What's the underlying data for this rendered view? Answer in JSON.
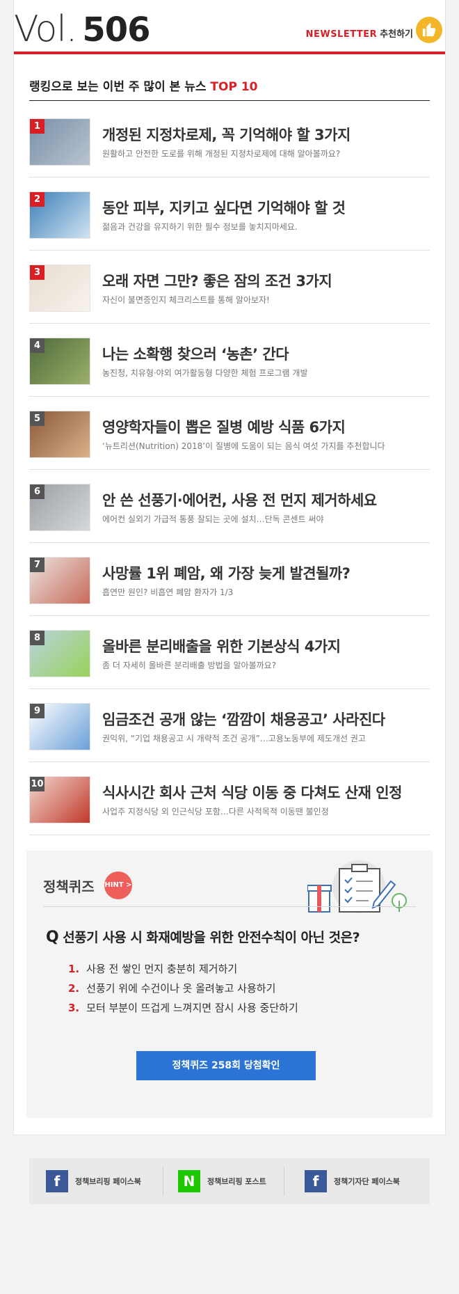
{
  "header": {
    "vol_label": "Vol.",
    "vol_number": "506",
    "newsletter_label": "NEWSLETTER",
    "recommend_label": "추천하기"
  },
  "ranking": {
    "title_prefix": "랭킹으로 보는 이번 주 많이 본 뉴스",
    "title_top": "TOP 10",
    "items": [
      {
        "rank": "1",
        "title": "개정된 지정차로제, 꼭 기억해야 할 3가지",
        "desc": "원활하고 안전한 도로를 위해 개정된 지정차로제에 대해 알아볼까요?",
        "badge_color": "#d81f26"
      },
      {
        "rank": "2",
        "title": "동안 피부, 지키고 싶다면 기억해야 할 것",
        "desc": "젊음과 건강을 유지하기 위한 필수 정보를 놓치지마세요.",
        "badge_color": "#d81f26"
      },
      {
        "rank": "3",
        "title": "오래 자면 그만? 좋은 잠의 조건 3가지",
        "desc": "자신이 불면증인지 체크리스트를 통해 알아보자!",
        "badge_color": "#d81f26"
      },
      {
        "rank": "4",
        "title": "나는 소확행 찾으러 ‘농촌’ 간다",
        "desc": "농진청, 치유형·야외 여가활동형 다양한 체험 프로그램 개발",
        "badge_color": "#555555"
      },
      {
        "rank": "5",
        "title": "영양학자들이 뽑은 질병 예방 식품 6가지",
        "desc": "‘뉴트리션(Nutrition) 2018’이 질병에 도움이 되는 음식 여섯 가지를 추천합니다",
        "badge_color": "#555555"
      },
      {
        "rank": "6",
        "title": "안 쓴 선풍기·에어컨, 사용 전 먼지 제거하세요",
        "desc": "에어컨 실외기 가급적 통풍 잘되는 곳에 설치…단독 콘센트 써야",
        "badge_color": "#555555"
      },
      {
        "rank": "7",
        "title": "사망률 1위 폐암, 왜 가장 늦게 발견될까?",
        "desc": "흡연만 원인? 비흡연 폐암 환자가 1/3",
        "badge_color": "#555555"
      },
      {
        "rank": "8",
        "title": "올바른 분리배출을 위한 기본상식 4가지",
        "desc": "좀 더 자세히 올바른 분리배출 방법을 알아볼까요?",
        "badge_color": "#555555"
      },
      {
        "rank": "9",
        "title": "임금조건 공개 않는 ‘깜깜이 채용공고’ 사라진다",
        "desc": "권익위, “기업 채용공고 시 개략적 조건 공개”…고용노동부에 제도개선 권고",
        "badge_color": "#555555"
      },
      {
        "rank": "10",
        "title": "식사시간 회사 근처 식당 이동 중 다쳐도 산재 인정",
        "desc": "사업주 지정식당 외 인근식당 포함…다른 사적목적 이동땐 불인정",
        "badge_color": "#555555"
      }
    ]
  },
  "quiz": {
    "label": "정책퀴즈",
    "hint_label": "HINT >",
    "q_mark": "Q",
    "question": "선풍기 사용 시 화재예방을 위한 안전수칙이 아닌 것은?",
    "options": [
      {
        "num": "1.",
        "text": "사용 전 쌓인 먼지 충분히 제거하기"
      },
      {
        "num": "2.",
        "text": "선풍기 위에 수건이나 옷 올려놓고 사용하기"
      },
      {
        "num": "3.",
        "text": "모터 부분이 뜨겁게 느껴지면 잠시 사용 중단하기"
      }
    ],
    "button_label": "정책퀴즈 258회 당첨확인"
  },
  "footer": {
    "links": [
      {
        "icon": "f",
        "label": "정책브리핑 페이스북",
        "color": "#3b5998"
      },
      {
        "icon": "N",
        "label": "정책브리핑 포스트",
        "color": "#1ec800"
      },
      {
        "icon": "f",
        "label": "정책기자단 페이스북",
        "color": "#3b5998"
      }
    ]
  }
}
